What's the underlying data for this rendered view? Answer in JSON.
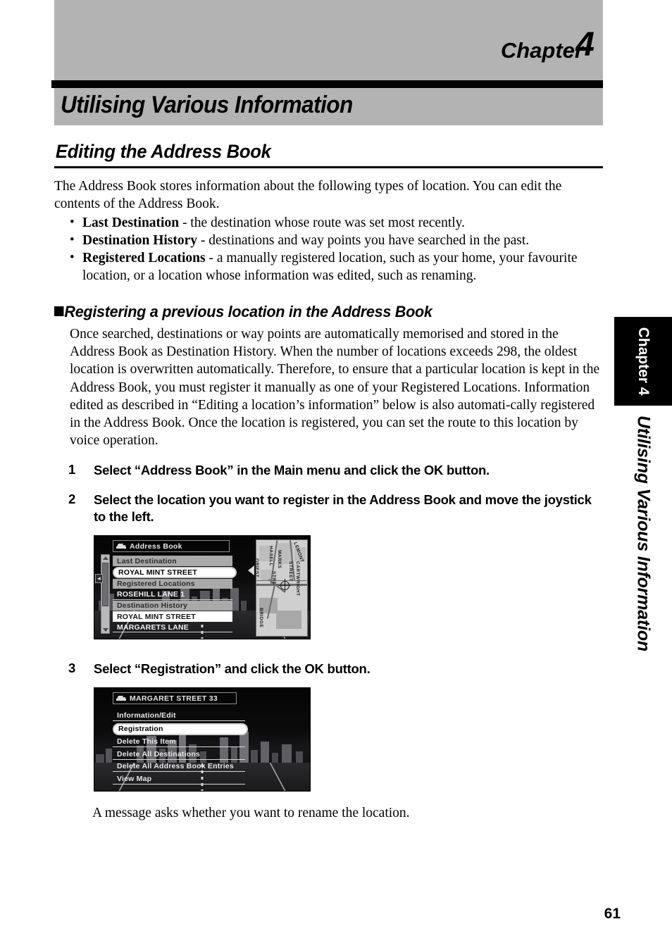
{
  "chapter_header": {
    "chapter_label": "Chapter",
    "chapter_number": "4",
    "chapter_title": "Utilising Various Information"
  },
  "section": {
    "title": "Editing the Address Book",
    "intro": "The Address Book stores information about the following types of location. You can edit the contents of the Address Book.",
    "bullets": [
      {
        "term": "Last Destination",
        "text": " - the destination whose route was set most recently."
      },
      {
        "term": "Destination History",
        "text": " - destinations and way points you have searched in the past."
      },
      {
        "term": "Registered Locations",
        "text": " - a manually registered location, such as your home, your favourite location, or a location whose information was edited, such as renaming."
      }
    ]
  },
  "subsection": {
    "title": "Registering a previous location in the Address Book",
    "paragraph": "Once searched, destinations or way points are automatically memorised and stored in the Address Book as Destination History. When the number of locations exceeds 298, the oldest location is overwritten automatically. Therefore, to ensure that a particular location is kept in the Address Book, you must register it manually as one of your Registered Locations. Information edited as described in “Editing a location’s information” below is also automati-cally registered in the Address Book. Once the location is registered, you can set the route to this location by voice operation."
  },
  "steps": [
    {
      "number": "1",
      "text": "Select “Address Book” in the Main menu and click the OK button."
    },
    {
      "number": "2",
      "text": "Select the location you want to register in the Address Book and move the joystick to the left."
    },
    {
      "number": "3",
      "text": "Select “Registration” and click the OK button."
    }
  ],
  "screenshot_address_book": {
    "titlebar": "Address Book",
    "rows": [
      {
        "label": "Last Destination",
        "style": "header"
      },
      {
        "label": "ROYAL MINT STREET",
        "style": "selected"
      },
      {
        "label": "Registered Locations",
        "style": "header"
      },
      {
        "label": "ROSEHILL LANE  1",
        "style": "dark"
      },
      {
        "label": "Destination History",
        "style": "header"
      },
      {
        "label": "ROYAL MINT STREET",
        "style": "item"
      },
      {
        "label": "MARGARETS LANE",
        "style": "dark"
      }
    ],
    "map_labels": [
      "MARKS",
      "STREET",
      "CARTWRIGHT",
      "LEMONT",
      "HASELL",
      "STRE",
      "BRIDGE",
      "ORIEST"
    ]
  },
  "screenshot_registration": {
    "titlebar": "MARGARET STREET  33",
    "rows": [
      {
        "label": "Information/Edit",
        "style": "item"
      },
      {
        "label": "Registration",
        "style": "selected"
      },
      {
        "label": "Delete This Item",
        "style": "item"
      },
      {
        "label": "Delete All Destinations",
        "style": "item"
      },
      {
        "label": "Delete All Address Book Entries",
        "style": "item"
      },
      {
        "label": "View Map",
        "style": "item"
      }
    ]
  },
  "result_note": "A message asks whether you want to rename the location.",
  "side_tab": {
    "chapter": "Chapter 4",
    "title": "Utilising Various Information"
  },
  "footer": {
    "page_number": "61"
  },
  "colors": {
    "band_grey": "#b3b3b3",
    "rule_black": "#000000",
    "screen_black": "#000000"
  }
}
